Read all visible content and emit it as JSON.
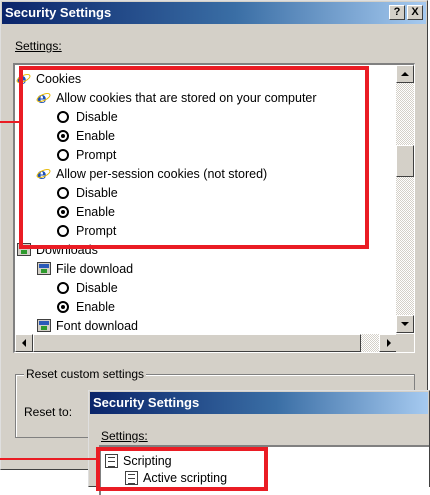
{
  "colors": {
    "highlight": "#ea1c24",
    "titlebar_start": "#0a246a",
    "titlebar_end": "#a6caf0",
    "dialog_bg": "#d4d0c8"
  },
  "dialog": {
    "title": "Security Settings",
    "help_button": "?",
    "close_button": "X",
    "settings_label": "Settings:",
    "tree": [
      {
        "text": "Cookies",
        "icon": "ie-icon"
      },
      {
        "text": "Allow cookies that are stored on your computer",
        "icon": "ie-icon"
      },
      {
        "text": "Disable",
        "icon": "radio-icon",
        "checked": false
      },
      {
        "text": "Enable",
        "icon": "radio-icon",
        "checked": true
      },
      {
        "text": "Prompt",
        "icon": "radio-icon",
        "checked": false
      },
      {
        "text": "Allow per-session cookies (not stored)",
        "icon": "ie-icon"
      },
      {
        "text": "Disable",
        "icon": "radio-icon",
        "checked": false
      },
      {
        "text": "Enable",
        "icon": "radio-icon",
        "checked": true
      },
      {
        "text": "Prompt",
        "icon": "radio-icon",
        "checked": false
      },
      {
        "text": "Downloads",
        "icon": "download-icon"
      },
      {
        "text": "File download",
        "icon": "download-icon"
      },
      {
        "text": "Disable",
        "icon": "radio-icon",
        "checked": false
      },
      {
        "text": "Enable",
        "icon": "radio-icon",
        "checked": true
      },
      {
        "text": "Font download",
        "icon": "download-icon"
      }
    ],
    "reset_group_label": "Reset custom settings",
    "reset_to_label": "Reset to:"
  },
  "overlay_dialog": {
    "title": "Security Settings",
    "settings_label": "Settings:",
    "tree": [
      {
        "text": "Scripting",
        "icon": "script-icon"
      },
      {
        "text": "Active scripting",
        "icon": "script-icon"
      }
    ]
  }
}
